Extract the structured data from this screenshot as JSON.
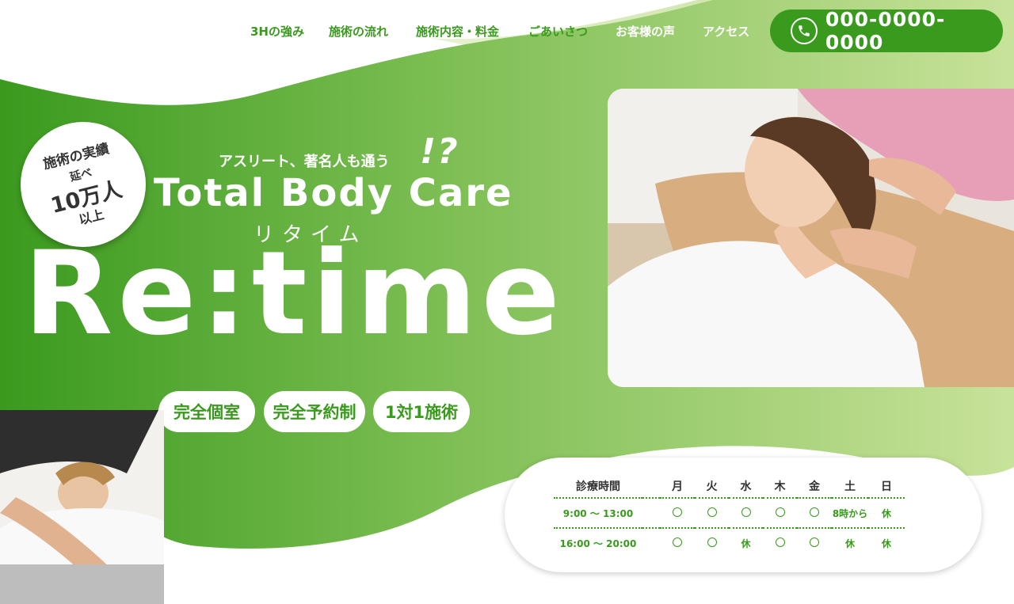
{
  "nav": {
    "items": [
      {
        "label": "3Hの強み"
      },
      {
        "label": "施術の流れ"
      },
      {
        "label": "施術内容・料金"
      },
      {
        "label": "ごあいさつ"
      },
      {
        "label": "お客様の声"
      },
      {
        "label": "アクセス"
      }
    ],
    "phone": "000-0000-0000"
  },
  "hero": {
    "badge": {
      "line1": "施術の実績",
      "line2": "延べ",
      "line3": "10万人",
      "line4": "以上"
    },
    "tagline": "アスリート、著名人も通う",
    "exclaim": "!?",
    "subtitle": "Total Body Care",
    "kana": "リタイム",
    "title": "Re:time",
    "features": [
      "完全個室",
      "完全予約制",
      "1対1施術"
    ]
  },
  "schedule": {
    "header": [
      "診療時間",
      "月",
      "火",
      "水",
      "木",
      "金",
      "土",
      "日"
    ],
    "rows": [
      {
        "time": "9:00 〜 13:00",
        "cells": [
          "circle",
          "circle",
          "circle",
          "circle",
          "circle",
          "8時から",
          "休"
        ]
      },
      {
        "time": "16:00 〜 20:00",
        "cells": [
          "circle",
          "circle",
          "休",
          "circle",
          "circle",
          "休",
          "休"
        ]
      }
    ]
  },
  "icons": {
    "phone": "phone-icon"
  },
  "colors": {
    "accent": "#3a9a1e",
    "light_green": "#c3df93",
    "white": "#ffffff"
  }
}
